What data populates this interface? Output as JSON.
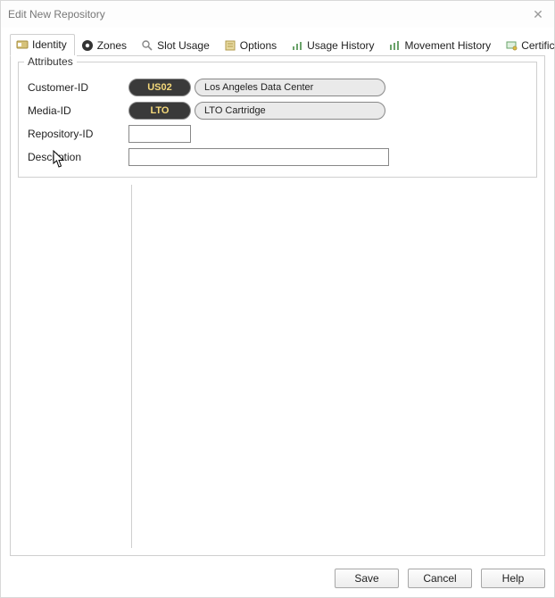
{
  "window": {
    "title": "Edit New Repository",
    "close_glyph": "✕"
  },
  "tabs": [
    {
      "label": "Identity",
      "icon": "identity-icon",
      "active": true
    },
    {
      "label": "Zones",
      "icon": "zones-icon",
      "active": false
    },
    {
      "label": "Slot Usage",
      "icon": "slot-icon",
      "active": false
    },
    {
      "label": "Options",
      "icon": "options-icon",
      "active": false
    },
    {
      "label": "Usage History",
      "icon": "usage-icon",
      "active": false
    },
    {
      "label": "Movement History",
      "icon": "move-icon",
      "active": false
    },
    {
      "label": "Certification",
      "icon": "cert-icon",
      "active": false
    }
  ],
  "attributes": {
    "legend": "Attributes",
    "labels": {
      "customer_id": "Customer-ID",
      "media_id": "Media-ID",
      "repository_id": "Repository-ID",
      "description": "Description"
    },
    "customer": {
      "code": "US02",
      "name": "Los Angeles Data Center"
    },
    "media": {
      "code": "LTO",
      "name": "LTO Cartridge"
    },
    "repository_id": "",
    "description": ""
  },
  "buttons": {
    "save": "Save",
    "cancel": "Cancel",
    "help": "Help"
  }
}
